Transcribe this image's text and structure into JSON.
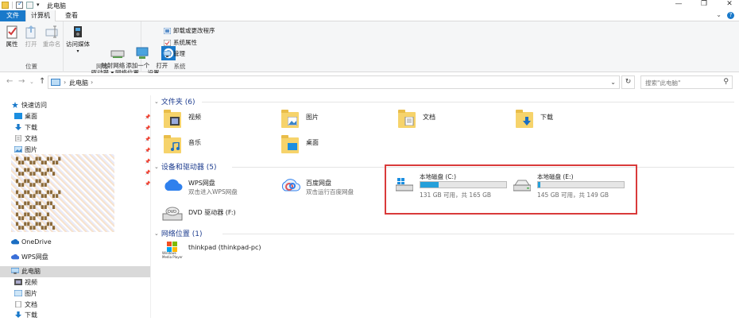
{
  "window": {
    "title": "此电脑",
    "controls": [
      "—",
      "❐",
      "✕"
    ]
  },
  "tabs": {
    "file": "文件",
    "computer": "计算机",
    "view": "查看",
    "help": "?",
    "expand": "⌄"
  },
  "ribbon": {
    "location": {
      "label": "位置",
      "properties": "属性",
      "open": "打开",
      "rename": "重命名"
    },
    "network": {
      "label": "网络",
      "access_media": "访问媒体",
      "map_drive": "映射网络\n驱动器 ▾",
      "add_location": "添加一个\n网络位置"
    },
    "system": {
      "label": "系统",
      "open_settings": "打开\n设置",
      "uninstall": "卸载或更改程序",
      "sys_props": "系统属性",
      "manage": "管理"
    }
  },
  "address": {
    "crumb_sep": "›",
    "crumb": "此电脑",
    "crumb_end": "›",
    "search_placeholder": "搜索\"此电脑\""
  },
  "navpane": {
    "quick_access": "快速访问",
    "items": [
      "桌面",
      "下载",
      "文档",
      "图片"
    ],
    "blurred": [
      "▚▞▚▞▚▞▚▞",
      "▚▞▚▞▚▞▚",
      "▚▞▚▞▚▞",
      "▚▞▚▞▚▞▚▞",
      "▚▞▚▞▚▞▚",
      "▚▞▚▞▚▞",
      "▚▞▚▞▚▞▚"
    ],
    "onedrive": "OneDrive",
    "wps": "WPS网盘",
    "this_pc": "此电脑",
    "pc_children": [
      "视频",
      "图片",
      "文档",
      "下载"
    ]
  },
  "folders_section": {
    "title": "文件夹 (6)",
    "items": [
      "视频",
      "图片",
      "文档",
      "下载",
      "音乐",
      "桌面"
    ]
  },
  "devices_section": {
    "title": "设备和驱动器 (5)",
    "wps": {
      "name": "WPS网盘",
      "sub": "双击进入WPS网盘"
    },
    "baidu": {
      "name": "百度网盘",
      "sub": "双击运行百度网盘"
    },
    "dvd": {
      "name": "DVD 驱动器 (F:)"
    },
    "drive_c": {
      "name": "本地磁盘 (C:)",
      "cap": "131 GB 可用，共 165 GB",
      "used_fraction": 0.21
    },
    "drive_e": {
      "name": "本地磁盘 (E:)",
      "cap": "145 GB 可用，共 149 GB",
      "used_fraction": 0.03
    }
  },
  "network_section": {
    "title": "网络位置 (1)",
    "item": "thinkpad (thinkpad-pc)",
    "item_logo": "Windows\nMedia Player"
  }
}
